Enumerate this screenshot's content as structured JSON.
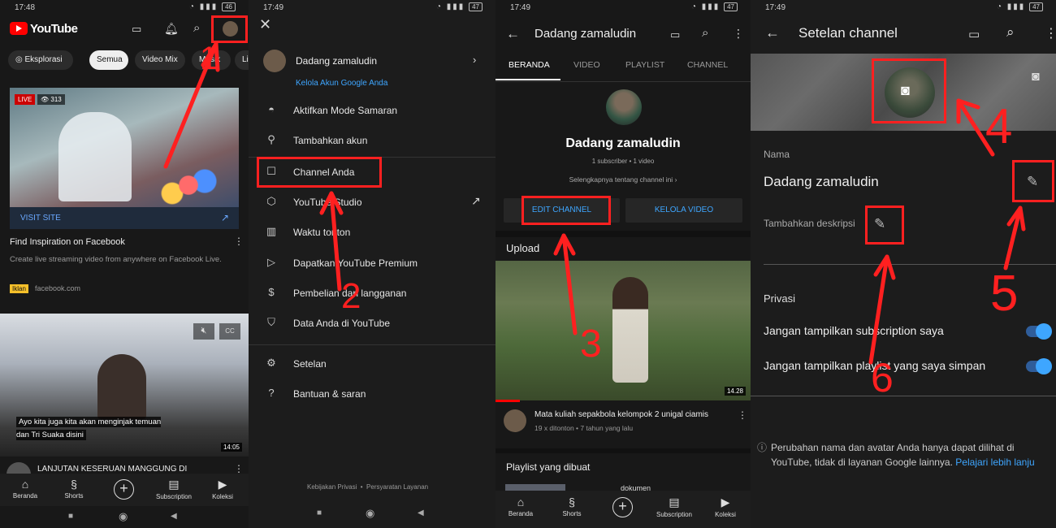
{
  "panel1": {
    "time": "17:48",
    "brand": "YouTube",
    "chips": [
      "Eksplorasi",
      "Semua",
      "Video Mix",
      "Musik",
      "Li"
    ],
    "ad": {
      "live_badge": "LIVE",
      "viewers": "313",
      "cta": "VISIT SITE",
      "title": "Find Inspiration on Facebook",
      "desc": "Create live streaming video from anywhere on Facebook Live.",
      "badge": "Iklan",
      "domain": "facebook.com"
    },
    "video": {
      "caption": "Ayo kita juga kita akan menginjak temuan dan Tri Suaka disini",
      "duration": "14:05",
      "title": "LANJUTAN KESERUAN MANGGUNG DI"
    },
    "nav": [
      "Beranda",
      "Shorts",
      "Subscription",
      "Koleksi"
    ],
    "step": "1"
  },
  "panel2": {
    "time": "17:49",
    "user": "Dadang zamaludin",
    "manage": "Kelola Akun Google Anda",
    "items": [
      "Aktifkan Mode Samaran",
      "Tambahkan akun",
      "Channel Anda",
      "YouTube Studio",
      "Waktu tonton",
      "Dapatkan YouTube Premium",
      "Pembelian dan langganan",
      "Data Anda di YouTube",
      "Setelan",
      "Bantuan & saran"
    ],
    "footer": "Kebijakan Privasi  •  Persyaratan Layanan",
    "step": "2"
  },
  "panel3": {
    "time": "17:49",
    "title": "Dadang zamaludin",
    "tabs": [
      "BERANDA",
      "VIDEO",
      "PLAYLIST",
      "CHANNEL"
    ],
    "channel_name": "Dadang zamaludin",
    "stats": "1 subscriber • 1 video",
    "more": "Selengkapnya tentang channel ini",
    "edit_btn": "EDIT CHANNEL",
    "manage_btn": "KELOLA VIDEO",
    "upload_label": "Upload",
    "duration": "14.28",
    "video_title": "Mata kuliah sepakbola kelompok 2 unigal ciamis",
    "video_meta": "19 x ditonton • 7 tahun yang lalu",
    "playlist_label": "Playlist yang dibuat",
    "playlist_item": "dokumen",
    "nav": [
      "Beranda",
      "Shorts",
      "Subscription",
      "Koleksi"
    ],
    "step": "3"
  },
  "panel4": {
    "time": "17:49",
    "title": "Setelan channel",
    "name_label": "Nama",
    "name_value": "Dadang zamaludin",
    "desc_label": "Tambahkan deskripsi",
    "privacy_label": "Privasi",
    "toggle1": "Jangan tampilkan subscription saya",
    "toggle2": "Jangan tampilkan playlist yang saya simpan",
    "info": "Perubahan nama dan avatar Anda hanya dapat dilihat di YouTube, tidak di layanan Google lainnya.",
    "info_link": "Pelajari lebih lanju",
    "steps": [
      "4",
      "5",
      "6"
    ]
  },
  "colors": {
    "background": "#181818",
    "annotation": "#ff2020",
    "link": "#3ea6ff",
    "youtube_red": "#ff0000"
  }
}
